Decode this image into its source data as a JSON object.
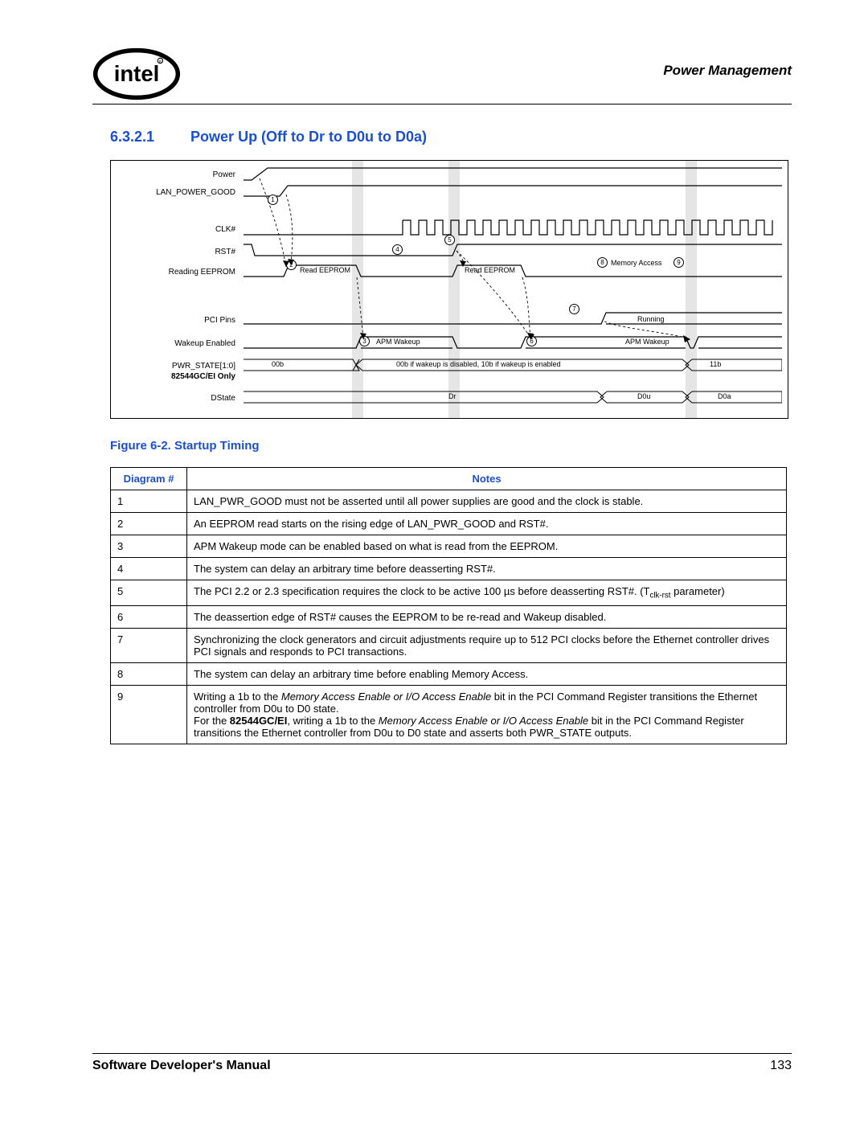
{
  "header": {
    "chapter_title": "Power Management"
  },
  "section": {
    "number": "6.3.2.1",
    "title": "Power Up (Off to Dr to D0u to D0a)"
  },
  "figure_caption": "Figure 6-2. Startup Timing",
  "diagram": {
    "signal_labels": [
      "Power",
      "LAN_POWER_GOOD",
      "CLK#",
      "RST#",
      "Reading EEPROM",
      "PCI Pins",
      "Wakeup Enabled",
      "PWR_STATE[1:0]",
      "82544GC/EI Only",
      "DState"
    ],
    "markers": [
      "1",
      "2",
      "3",
      "4",
      "5",
      "6",
      "7",
      "8",
      "9"
    ],
    "text": {
      "read_eeprom": "Read EEPROM",
      "memory_access": "Memory Access",
      "running": "Running",
      "apm_wakeup": "APM Wakeup",
      "pwr_00b": "00b",
      "pwr_mid": "00b if wakeup is disabled, 10b if wakeup is enabled",
      "pwr_11b": "11b",
      "dr": "Dr",
      "d0u": "D0u",
      "d0a": "D0a"
    }
  },
  "table": {
    "headers": [
      "Diagram #",
      "Notes"
    ],
    "rows": [
      {
        "n": "1",
        "note_html": "LAN_PWR_GOOD must not be asserted until all power supplies are good and the clock is stable."
      },
      {
        "n": "2",
        "note_html": "An EEPROM read starts on the rising edge of LAN_PWR_GOOD and RST#."
      },
      {
        "n": "3",
        "note_html": "APM Wakeup mode can be enabled based on what is read from the EEPROM."
      },
      {
        "n": "4",
        "note_html": "The system can delay an arbitrary time before deasserting RST#."
      },
      {
        "n": "5",
        "note_html": "The PCI 2.2 or 2.3 specification requires the clock to be active 100 µs before deasserting RST#. (T<sub>clk-rst</sub> parameter)"
      },
      {
        "n": "6",
        "note_html": "The deassertion edge of RST# causes the EEPROM to be re-read and Wakeup disabled."
      },
      {
        "n": "7",
        "note_html": "Synchronizing the clock generators and circuit adjustments require up to 512 PCI clocks before the Ethernet controller drives PCI signals and responds to PCI transactions."
      },
      {
        "n": "8",
        "note_html": "The system can delay an arbitrary time before enabling Memory Access."
      },
      {
        "n": "9",
        "note_html": "Writing a 1b to the <em class='ital'>Memory Access Enable or I/O Access Enable</em> bit in the PCI Command Register transitions the Ethernet controller from D0u to D0 state.<br>For the <b>82544GC/EI</b>, writing a 1b to the <em class='ital'>Memory Access Enable or I/O Access Enable</em> bit in the PCI Command Register transitions the Ethernet controller from D0u to D0 state and asserts both PWR_STATE outputs."
      }
    ]
  },
  "footer": {
    "title": "Software Developer's Manual",
    "page": "133"
  }
}
